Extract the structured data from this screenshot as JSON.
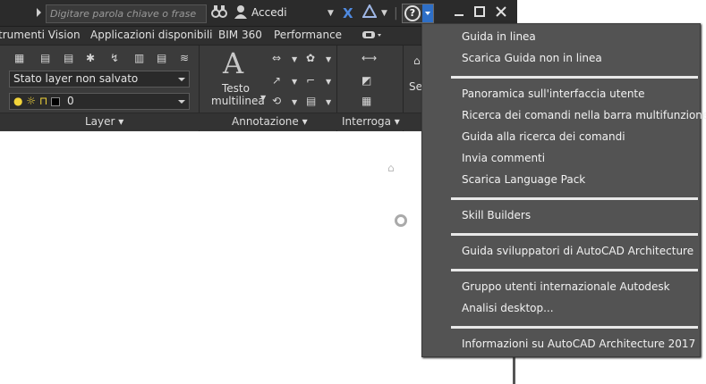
{
  "titlebar": {
    "search_placeholder": "Digitare parola chiave o frase",
    "signin_label": "Accedi",
    "icons": [
      "binoculars-icon",
      "user-icon",
      "exchange-x-icon",
      "a360-icon",
      "help-icon",
      "minimize-icon",
      "maximize-icon",
      "close-icon"
    ]
  },
  "tabs": [
    "trumenti Vision",
    "Applicazioni disponibili",
    "BIM 360",
    "Performance"
  ],
  "ribbon": {
    "layer_state_value": "Stato layer non salvato",
    "layer_current_value": "0",
    "text_button_line1": "Testo",
    "text_button_line2": "multilinea",
    "text_glyph": "A",
    "partial_label": "Sez",
    "panels": {
      "layer": "Layer",
      "annotation": "Annotazione",
      "query": "Interroga"
    }
  },
  "help_menu": {
    "groups": [
      [
        "Guida in linea",
        "Scarica Guida non in linea"
      ],
      [
        "Panoramica sull'interfaccia utente",
        "Ricerca dei comandi nella barra multifunzione",
        "Guida alla ricerca dei comandi",
        "Invia commenti",
        "Scarica Language Pack"
      ],
      [
        "Skill Builders"
      ],
      [
        "Guida sviluppatori di AutoCAD Architecture"
      ],
      [
        "Gruppo utenti internazionale Autodesk",
        "Analisi desktop..."
      ],
      [
        "Informazioni su AutoCAD Architecture 2017"
      ]
    ]
  },
  "colors": {
    "menu_bg": "#535353",
    "titlebar_bg": "#2b2b2b",
    "ribbon_bg": "#3b3b3b",
    "help_accent": "#2e6fc7"
  }
}
